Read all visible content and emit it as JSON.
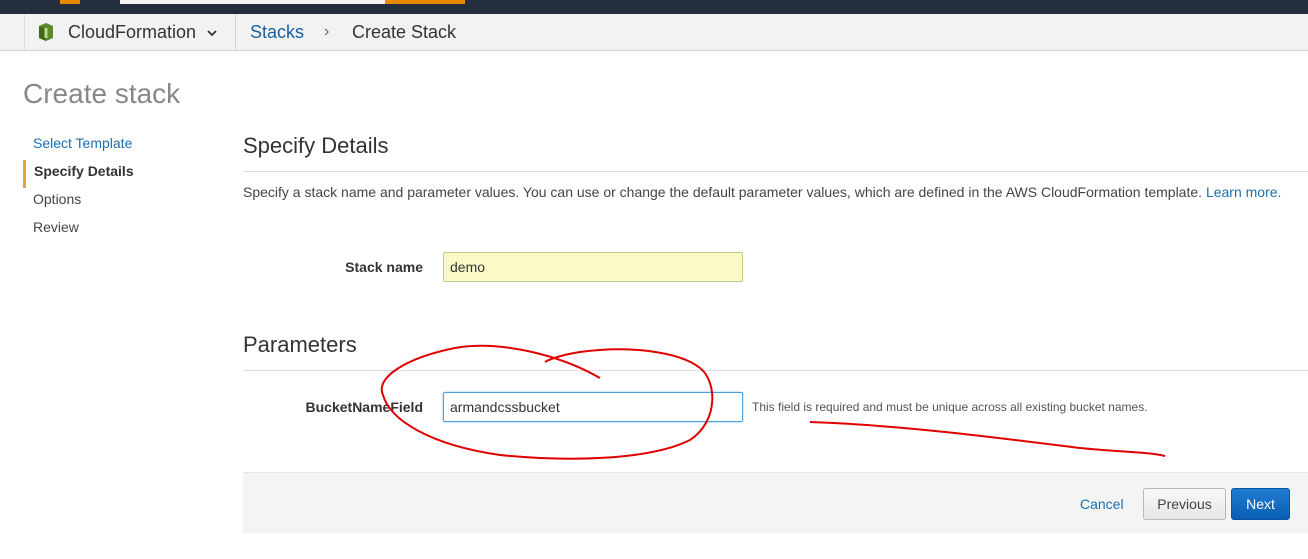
{
  "header": {
    "service_name": "CloudFormation",
    "breadcrumb_link": "Stacks",
    "breadcrumb_separator": "›",
    "breadcrumb_current": "Create Stack"
  },
  "page": {
    "title": "Create stack"
  },
  "steps": [
    {
      "label": "Select Template",
      "state": "link"
    },
    {
      "label": "Specify Details",
      "state": "active"
    },
    {
      "label": "Options",
      "state": "plain"
    },
    {
      "label": "Review",
      "state": "plain"
    }
  ],
  "details": {
    "heading": "Specify Details",
    "description": "Specify a stack name and parameter values. You can use or change the default parameter values, which are defined in the AWS CloudFormation template.",
    "learn_more": "Learn more.",
    "stack_name_label": "Stack name",
    "stack_name_value": "demo"
  },
  "parameters": {
    "heading": "Parameters",
    "bucket_label": "BucketNameField",
    "bucket_value": "armandcssbucket",
    "bucket_hint": "This field is required and must be unique across all existing bucket names."
  },
  "footer": {
    "cancel_label": "Cancel",
    "previous_label": "Previous",
    "next_label": "Next"
  },
  "icons": {
    "service_icon": "cloudformation-icon",
    "dropdown_icon": "chevron-down-icon"
  },
  "colors": {
    "link": "#1a6fb0",
    "primary_button": "#0a5fb4",
    "active_step_marker": "#e9a23b",
    "highlighted_input": "#fafac6",
    "annotation": "#e00000"
  }
}
